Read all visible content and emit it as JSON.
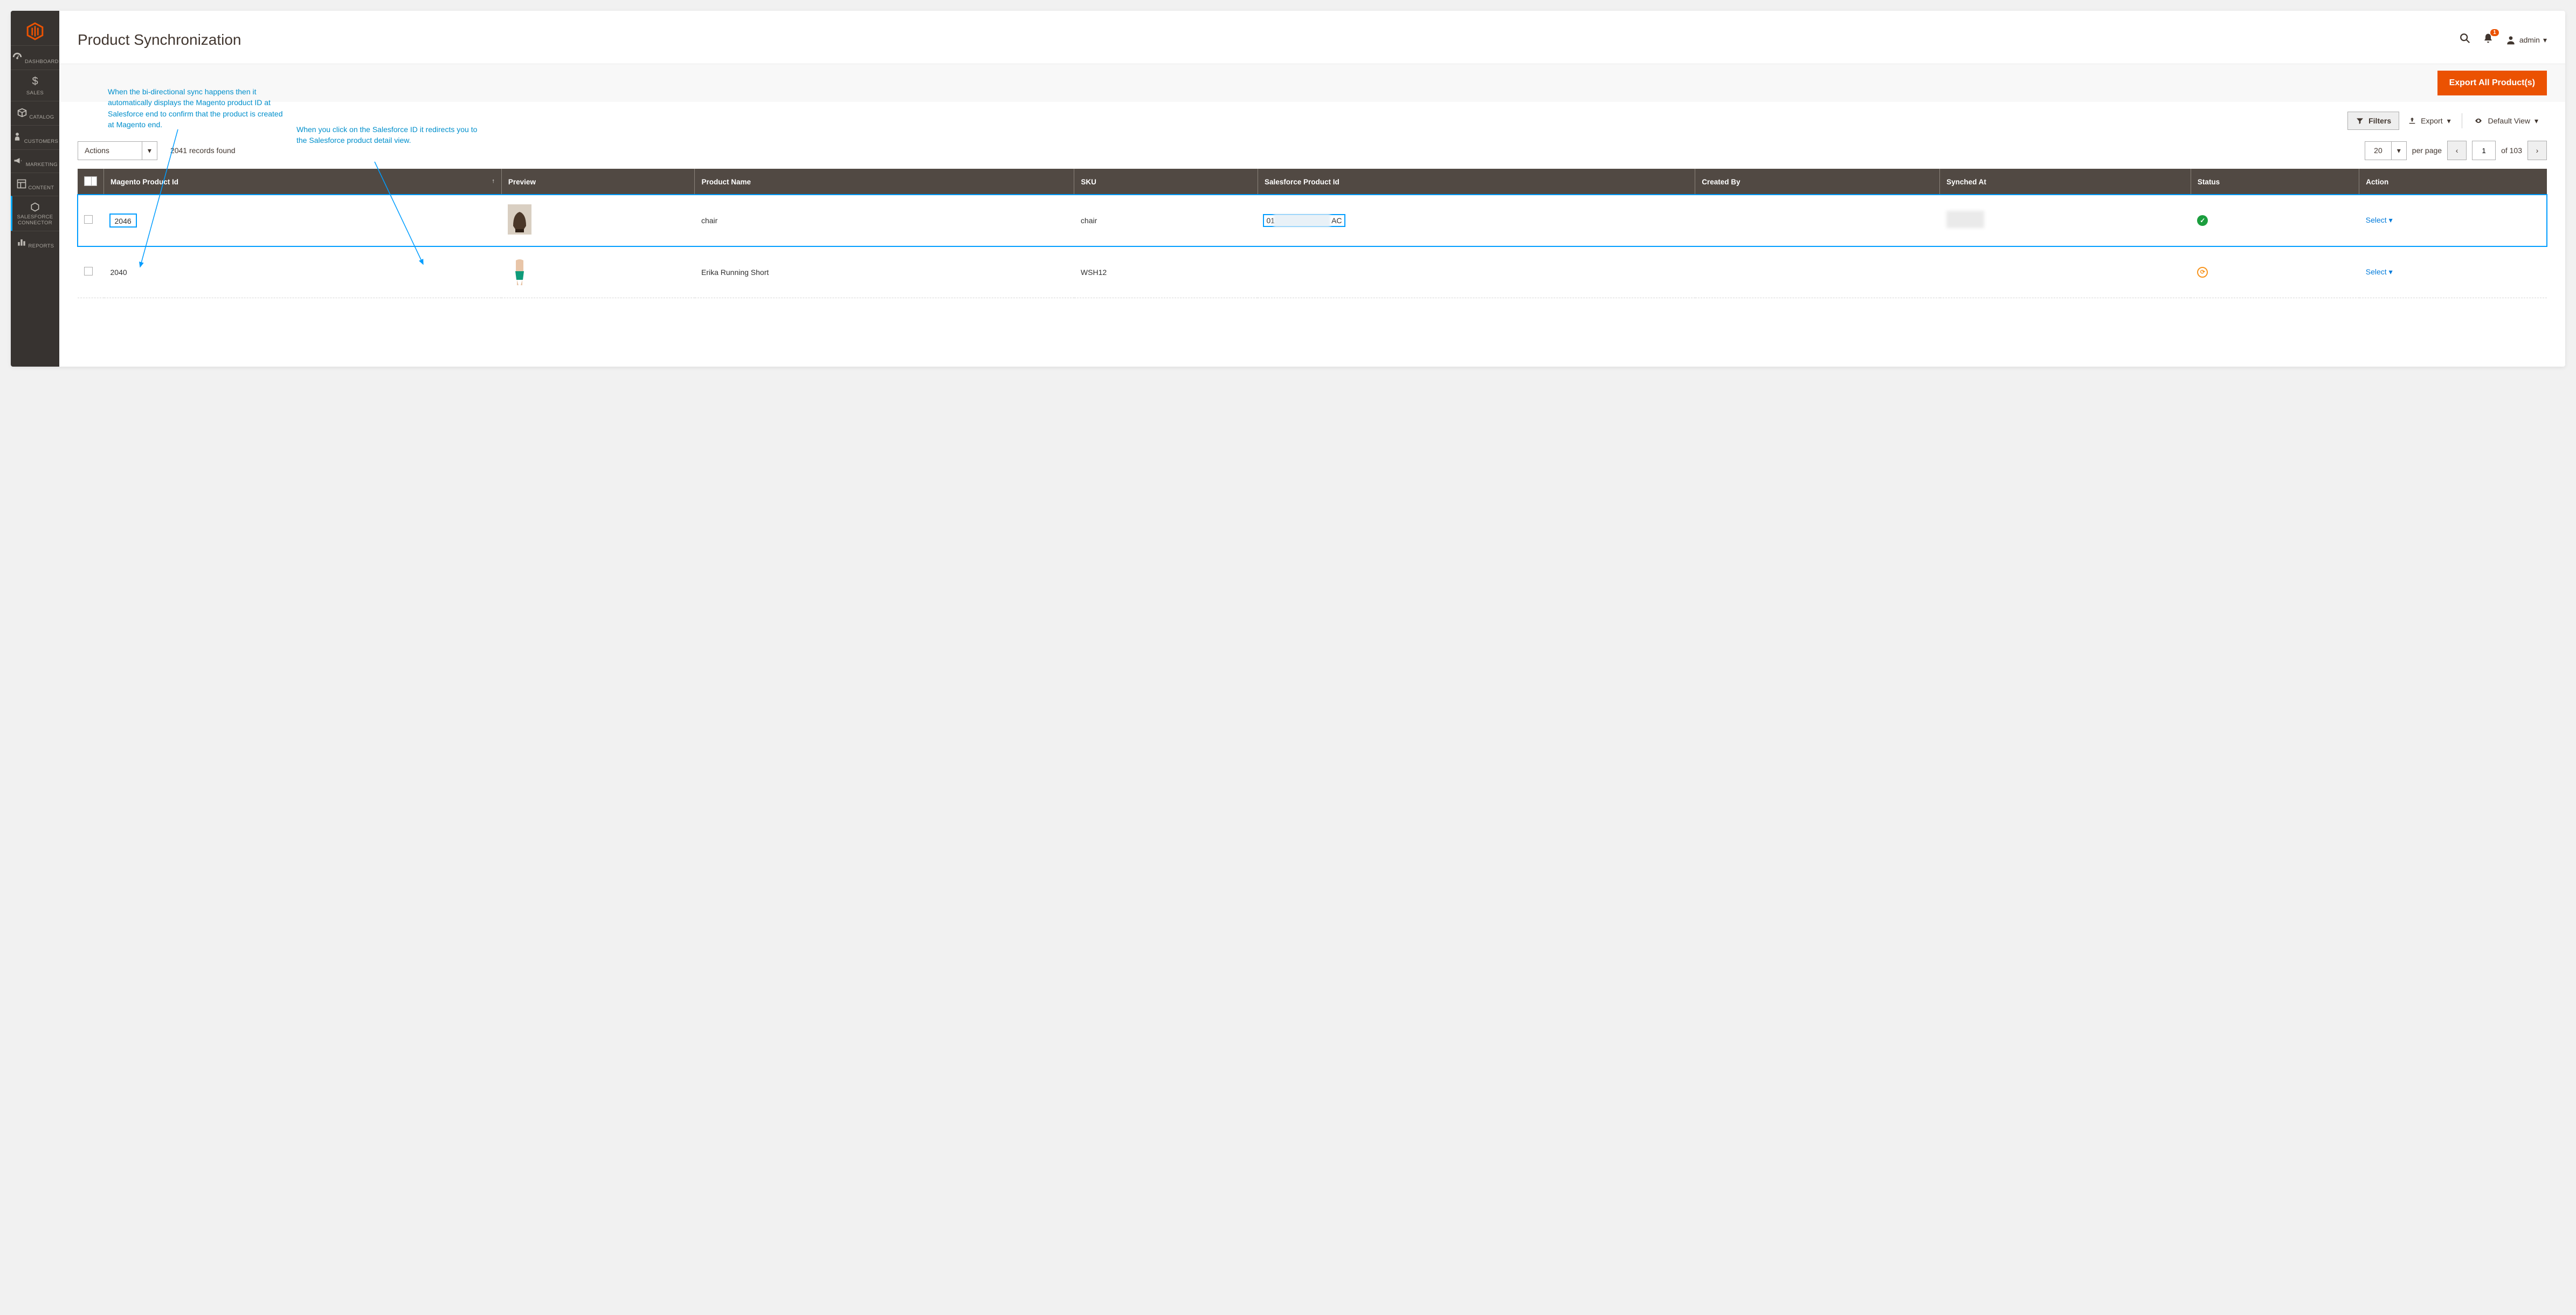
{
  "header": {
    "title": "Product Synchronization",
    "notification_count": "1",
    "admin_label": "admin"
  },
  "sidebar": {
    "items": [
      {
        "label": "DASHBOARD"
      },
      {
        "label": "SALES"
      },
      {
        "label": "CATALOG"
      },
      {
        "label": "CUSTOMERS"
      },
      {
        "label": "MARKETING"
      },
      {
        "label": "CONTENT"
      },
      {
        "label": "SALESFORCE CONNECTOR"
      },
      {
        "label": "REPORTS"
      }
    ]
  },
  "toolbar": {
    "export_all": "Export All Product(s)",
    "filters": "Filters",
    "export": "Export",
    "default_view": "Default View",
    "actions": "Actions",
    "records_found": "2041 records found",
    "per_page_value": "20",
    "per_page_label": "per page",
    "page_current": "1",
    "page_total": "of 103"
  },
  "columns": {
    "c1": "Magento Product Id",
    "c2": "Preview",
    "c3": "Product Name",
    "c4": "SKU",
    "c5": "Salesforce Product Id",
    "c6": "Created By",
    "c7": "Synched At",
    "c8": "Status",
    "c9": "Action"
  },
  "rows": [
    {
      "magento_id": "2046",
      "name": "chair",
      "sku": "chair",
      "sf_prefix": "01",
      "sf_suffix": "AC",
      "action": "Select",
      "status": "ok"
    },
    {
      "magento_id": "2040",
      "name": "Erika Running Short",
      "sku": "WSH12",
      "sf_prefix": "",
      "sf_suffix": "",
      "action": "Select",
      "status": "sync"
    }
  ],
  "annotations": {
    "left": "When the bi-directional sync happens then it automatically displays the Magento product ID at Salesforce end to confirm that the product is created at Magento end.",
    "right": "When you click on the Salesforce ID it redirects you to the Salesforce product detail view."
  }
}
